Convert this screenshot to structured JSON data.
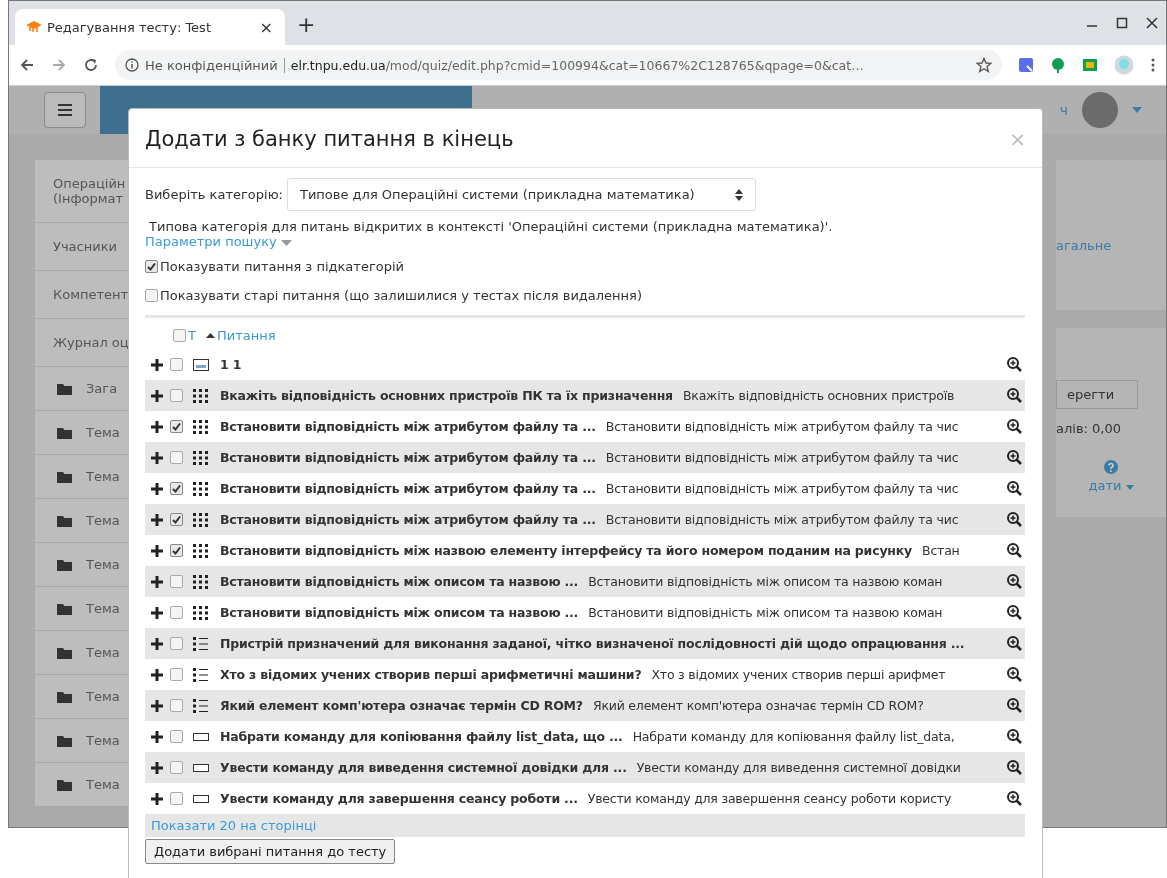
{
  "browser": {
    "tab_title": "Редагування тесту: Test",
    "tab_close": "×",
    "new_tab": "+",
    "security": "Не конфіденційний",
    "url_host": "elr.tnpu.edu.ua",
    "url_path": "/mod/quiz/edit.php?cmid=100994&cat=10667%2C128765&qpage=0&cat…"
  },
  "background": {
    "user_name": "ч",
    "sidebar": [
      "Операційн\n(Інформат",
      "Учасники",
      "Компетент",
      "Журнал оц"
    ],
    "sections": [
      "Зага",
      "Тема",
      "Тема",
      "Тема",
      "Тема",
      "Тема",
      "Тема",
      "Тема",
      "Тема",
      "Тема"
    ],
    "link": "агальне",
    "save_button": "ерегти",
    "grade": "алів: 0,00",
    "add_menu": "дати"
  },
  "modal": {
    "title": "Додати з банку питання в кінець",
    "close": "×",
    "category_label": "Виберіть категорію:",
    "category_value": "Типове для Операційні системи (прикладна математика)",
    "category_info": "Типова категорія для питань відкритих в контексті 'Операційні системи (прикладна математика)'.",
    "search_options": "Параметри пошуку",
    "options": [
      {
        "label": "Показувати питання з підкатегорій",
        "checked": true
      },
      {
        "label": "Показувати старі питання (що залишилися у тестах після видалення)",
        "checked": false
      }
    ],
    "header": {
      "select_all": false,
      "type": "Т",
      "question": "Питання"
    },
    "rows": [
      {
        "kind": "description",
        "checked": false,
        "name": "1 1",
        "text": ""
      },
      {
        "kind": "matching",
        "checked": false,
        "name": "Вкажіть відповідність основних пристроїв ПК та їх призначення",
        "text": "Вкажіть відповідність основних пристроїв"
      },
      {
        "kind": "matching",
        "checked": true,
        "name": "Встановити відповідність між атрибутом файлу та ...",
        "text": "Встановити відповідність між атрибутом файлу та чис"
      },
      {
        "kind": "matching",
        "checked": false,
        "name": "Встановити відповідність між атрибутом файлу та ...",
        "text": "Встановити відповідність між атрибутом файлу та чис"
      },
      {
        "kind": "matching",
        "checked": true,
        "name": "Встановити відповідність між атрибутом файлу та ...",
        "text": "Встановити відповідність між атрибутом файлу та чис"
      },
      {
        "kind": "matching",
        "checked": true,
        "name": "Встановити відповідність між атрибутом файлу та ...",
        "text": "Встановити відповідність між атрибутом файлу та чис"
      },
      {
        "kind": "matching",
        "checked": true,
        "name": "Встановити відповідність між назвою елементу інтерфейсу та його номером поданим на рисунку",
        "text": "Встан"
      },
      {
        "kind": "matching",
        "checked": false,
        "name": "Встановити відповідність між описом та назвою ...",
        "text": "Встановити відповідність між описом та назвою коман"
      },
      {
        "kind": "matching",
        "checked": false,
        "name": "Встановити відповідність між описом та назвою ...",
        "text": "Встановити відповідність між описом та назвою коман"
      },
      {
        "kind": "multichoice",
        "checked": false,
        "name": "Пристрій призначений для виконання заданої, чітко визначеної послідовності дій щодо опрацювання ...",
        "text": ""
      },
      {
        "kind": "multichoice",
        "checked": false,
        "name": "Хто з відомих учених створив перші арифметичні машини?",
        "text": "Хто з відомих учених створив перші арифмет"
      },
      {
        "kind": "multichoice",
        "checked": false,
        "name": "Який елемент комп'ютера означає термін CD ROM?",
        "text": "Який елемент комп'ютера означає термін CD ROM?"
      },
      {
        "kind": "shortanswer",
        "checked": false,
        "name": "Набрати команду для копіювання файлу list_data, що ...",
        "text": "Набрати команду для копіювання файлу list_data,"
      },
      {
        "kind": "shortanswer",
        "checked": false,
        "name": "Увести команду для виведення системної довідки для ...",
        "text": "Увести команду для виведення системної довідки"
      },
      {
        "kind": "shortanswer",
        "checked": false,
        "name": "Увести команду для завершення сеансу роботи ...",
        "text": "Увести команду для завершення сеансу роботи користу"
      }
    ],
    "pager": "Показати 20 на сторінці",
    "add_button": "Додати вибрані питання до тесту"
  }
}
